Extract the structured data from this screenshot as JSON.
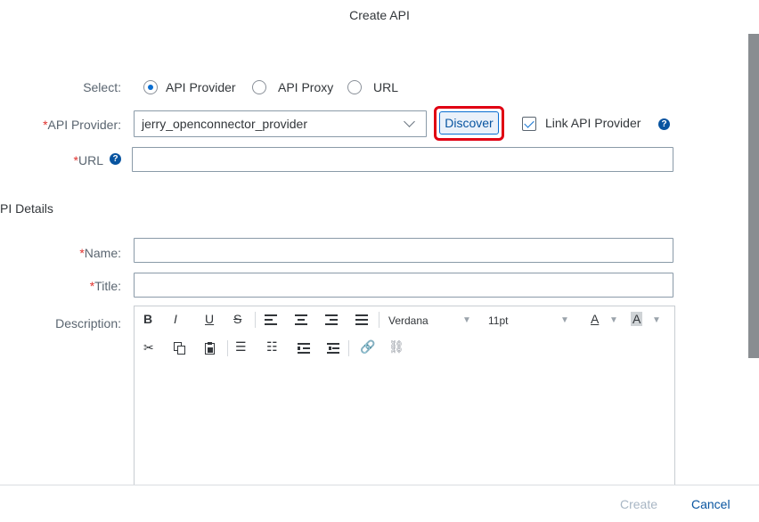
{
  "dialog": {
    "title": "Create API"
  },
  "select": {
    "label": "Select:",
    "options": [
      {
        "label": "API Provider",
        "selected": true
      },
      {
        "label": "API Proxy",
        "selected": false
      },
      {
        "label": "URL",
        "selected": false
      }
    ]
  },
  "provider": {
    "required_mark": "*",
    "label": "API Provider:",
    "value": "jerry_openconnector_provider",
    "discover_label": "Discover",
    "link_label": "Link API Provider",
    "link_checked": true
  },
  "url": {
    "required_mark": "*",
    "label": "URL",
    "value": ""
  },
  "details": {
    "section_title": "PI Details",
    "name": {
      "required_mark": "*",
      "label": "Name:",
      "value": ""
    },
    "title": {
      "required_mark": "*",
      "label": "Title:",
      "value": ""
    },
    "description": {
      "label": "Description:",
      "font_family": "Verdana",
      "font_size": "11pt",
      "toolbar_row1": [
        "B",
        "I",
        "U",
        "S"
      ],
      "text_color_label": "A",
      "highlight_label": "A"
    }
  },
  "footer": {
    "create_label": "Create",
    "cancel_label": "Cancel"
  },
  "colors": {
    "accent": "#0a6ed1",
    "required": "#e0322e",
    "highlight": "#e00012"
  }
}
